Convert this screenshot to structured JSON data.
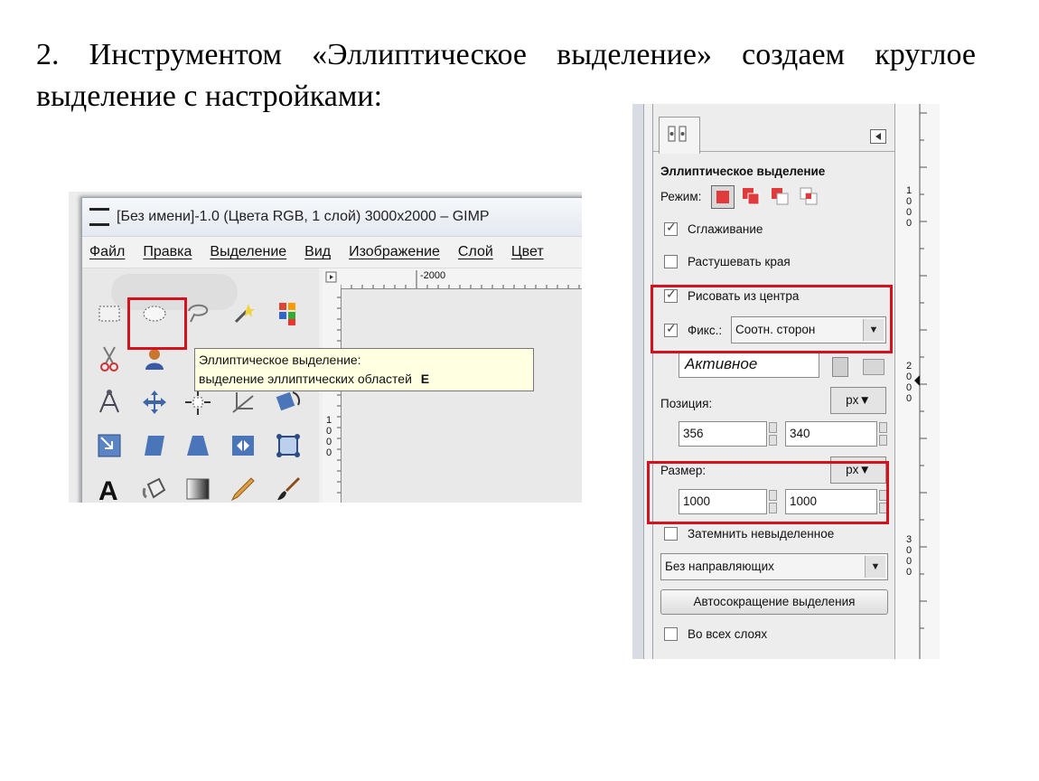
{
  "slide": {
    "title": "2. Инструментом «Эллиптическое выделение» создаем круглое выделение с настройками:"
  },
  "gimp_window": {
    "title": "[Без имени]-1.0 (Цвета RGB, 1 слой) 3000x2000 – GIMP",
    "menu": [
      "Файл",
      "Правка",
      "Выделение",
      "Вид",
      "Изображение",
      "Слой",
      "Цвет"
    ],
    "ruler_top_label": "-2000",
    "ruler_left_label": "1000",
    "tooltip": {
      "line1": "Эллиптическое выделение:",
      "line2": "выделение эллиптических областей",
      "shortcut": "E"
    },
    "tools": [
      "rect-select-icon",
      "ellipse-select-icon",
      "free-select-icon",
      "fuzzy-select-icon",
      "color-select-icon",
      "scissors-icon",
      "foreground-select-icon",
      "paths-icon",
      "move-icon",
      "align-icon",
      "crop-icon",
      "rotate-icon",
      "scale-icon",
      "shear-icon",
      "perspective-icon",
      "flip-icon",
      "cage-icon",
      "text-icon",
      "bucket-fill-icon",
      "blend-icon",
      "pencil-icon",
      "paintbrush-icon"
    ]
  },
  "tool_options": {
    "heading": "Эллиптическое выделение",
    "mode_label": "Режим:",
    "antialiasing": {
      "label": "Сглаживание",
      "checked": true
    },
    "feather": {
      "label": "Растушевать края",
      "checked": false
    },
    "expand_from_center": {
      "label": "Рисовать из центра",
      "checked": true
    },
    "fixed": {
      "label": "Фикс.:",
      "checked": true,
      "value": "Соотн. сторон"
    },
    "fixed_field": "Активное",
    "position": {
      "label": "Позиция:",
      "unit": "px",
      "x": "356",
      "y": "340"
    },
    "size": {
      "label": "Размер:",
      "unit": "px",
      "w": "1000",
      "h": "1000"
    },
    "highlight": {
      "label": "Затемнить невыделенное",
      "checked": false
    },
    "guides": "Без направляющих",
    "auto_shrink": "Автосокращение выделения",
    "all_layers": {
      "label": "Во всех слоях",
      "checked": false
    },
    "ruler_labels": [
      "1000",
      "2000",
      "3000"
    ]
  },
  "colors": {
    "highlight_red": "#d3111f",
    "mode_red": "#e03a3a"
  }
}
